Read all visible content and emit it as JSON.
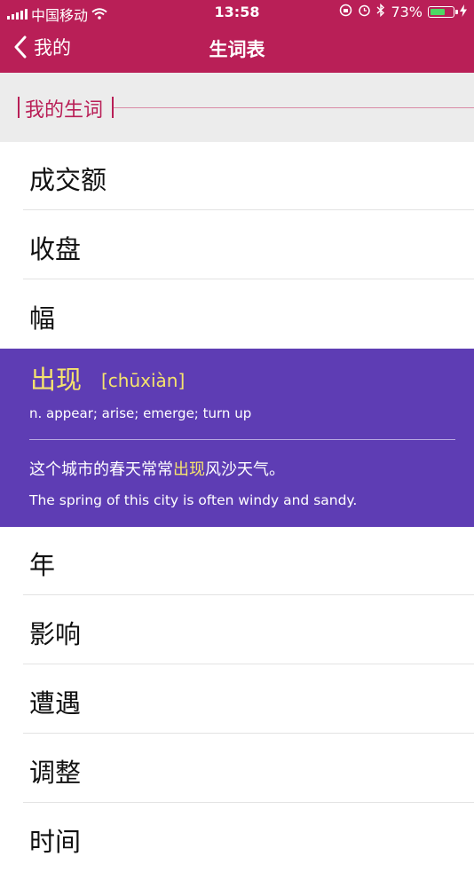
{
  "status": {
    "carrier": "中国移动",
    "time": "13:58",
    "battery": "73%",
    "battery_level": 0.73
  },
  "nav": {
    "back_label": "我的",
    "title": "生词表"
  },
  "section": {
    "title": "我的生词"
  },
  "words_before": [
    "成交额",
    "收盘",
    "幅"
  ],
  "selected": {
    "word": "出现",
    "pinyin": "[chūxiàn]",
    "definition": "n. appear; arise; emerge; turn up",
    "example_before": "这个城市的春天常常",
    "example_highlight": "出现",
    "example_after": "风沙天气。",
    "translation": "The spring of this city is often windy and sandy."
  },
  "words_after": [
    "年",
    "影响",
    "遭遇",
    "调整",
    "时间"
  ],
  "colors": {
    "header": "#b91f57",
    "card": "#5e3db4",
    "highlight": "#f6e46d"
  }
}
